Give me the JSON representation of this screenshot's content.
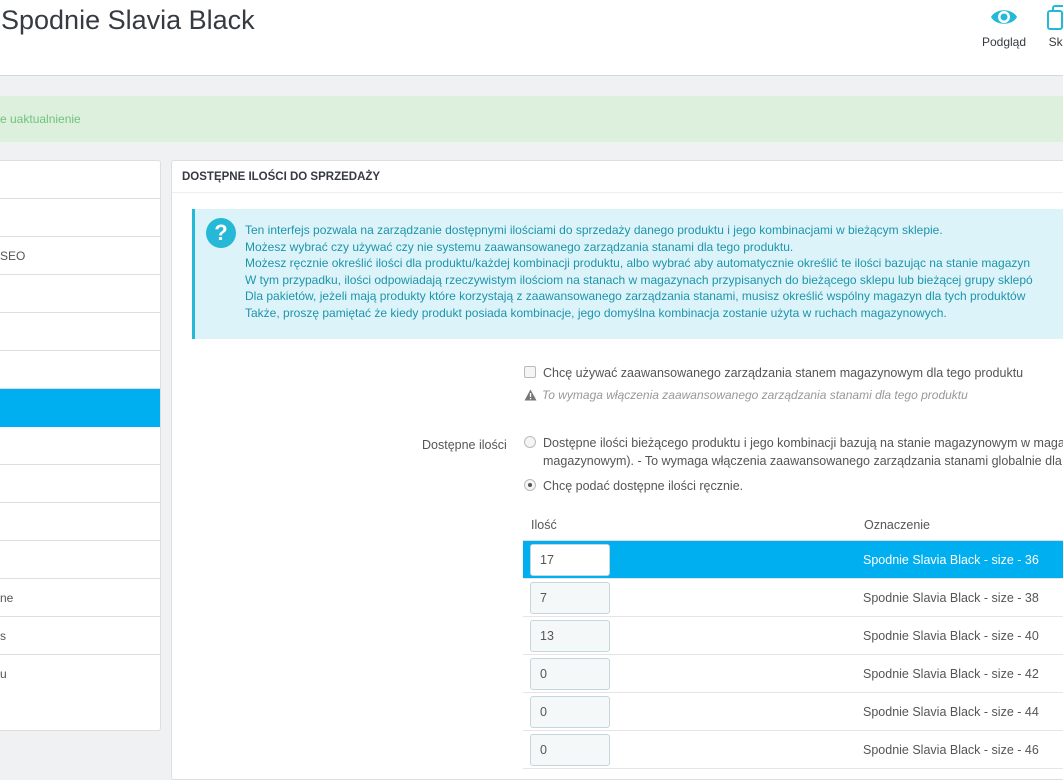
{
  "header": {
    "title": "Spodnie Slavia Black",
    "preview_label": "Podgląd",
    "copy_label": "Sko"
  },
  "alert": {
    "text": "e uaktualnienie"
  },
  "sidebar": {
    "items": [
      {
        "label": ""
      },
      {
        "label": ""
      },
      {
        "label": "SEO"
      },
      {
        "label": ""
      },
      {
        "label": ""
      },
      {
        "label": ""
      },
      {
        "label": "",
        "active": true
      },
      {
        "label": ""
      },
      {
        "label": ""
      },
      {
        "label": ""
      },
      {
        "label": ""
      },
      {
        "label": "ne"
      },
      {
        "label": "s"
      },
      {
        "label": "u"
      }
    ]
  },
  "panel": {
    "heading": "DOSTĘPNE ILOŚCI DO SPRZEDAŻY",
    "info_lines": [
      "Ten interfejs pozwala na zarządzanie dostępnymi ilościami do sprzedaży danego produktu i jego kombinacjami w bieżącym sklepie.",
      "Możesz wybrać czy używać czy nie systemu zaawansowanego zarządzania stanami dla tego produktu.",
      "Możesz ręcznie określić ilości dla produktu/każdej kombinacji produktu, albo wybrać aby automatycznie określić te ilości bazując na stanie magazyn",
      "W tym przypadku, ilości odpowiadają rzeczywistym ilościom na stanach w magazynach przypisanych do bieżącego sklepu lub bieżącej grupy sklepó",
      "Dla pakietów, jeżeli mają produkty które korzystają z zaawansowanego zarządzania stanami, musisz określić wspólny magazyn dla tych produktów",
      "Także, proszę pamiętać że kiedy produkt posiada kombinacje, jego domyślna kombinacja zostanie użyta w ruchach magazynowych."
    ],
    "advanced_checkbox_label": "Chcę używać zaawansowanego zarządzania stanem magazynowym dla tego produktu",
    "warning_text": "To wymaga włączenia zaawansowanego zarządzania stanami dla tego produktu",
    "qty_label": "Dostępne ilości",
    "radio_auto_line1": "Dostępne ilości bieżącego produktu i jego kombinacji bazują na stanie magazynowym w maga",
    "radio_auto_line2": "magazynowym).  - To wymaga włączenia zaawansowanego zarządzania stanami globalnie dla",
    "radio_manual": "Chcę podać dostępne ilości ręcznie.",
    "table": {
      "col_qty": "Ilość",
      "col_designation": "Oznaczenie",
      "rows": [
        {
          "qty": "17",
          "designation": "Spodnie Slavia Black - size - 36",
          "selected": true
        },
        {
          "qty": "7",
          "designation": "Spodnie Slavia Black - size - 38"
        },
        {
          "qty": "13",
          "designation": "Spodnie Slavia Black - size - 40"
        },
        {
          "qty": "0",
          "designation": "Spodnie Slavia Black - size - 42"
        },
        {
          "qty": "0",
          "designation": "Spodnie Slavia Black - size - 44"
        },
        {
          "qty": "0",
          "designation": "Spodnie Slavia Black - size - 46"
        }
      ]
    }
  },
  "colors": {
    "accent": "#00aff0",
    "info": "#25b9d7",
    "success": "#72c279"
  }
}
